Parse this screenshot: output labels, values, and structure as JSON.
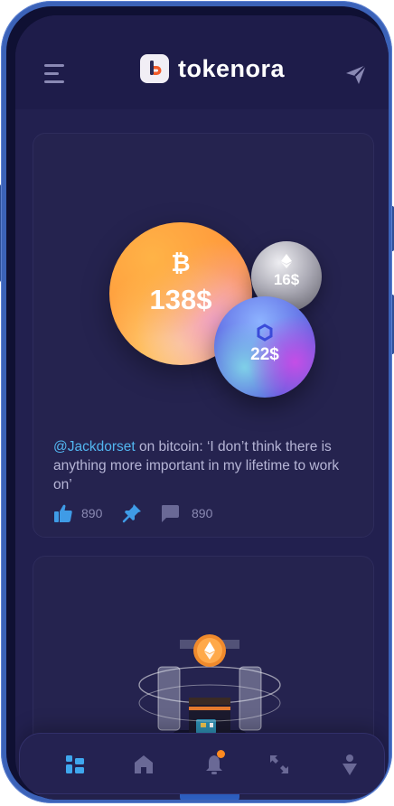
{
  "app": {
    "name": "tokenora"
  },
  "header": {
    "menu_icon": "hamburger-menu-icon",
    "send_icon": "paper-plane-icon"
  },
  "feed": {
    "post1": {
      "bubbles": [
        {
          "coin": "bitcoin",
          "icon": "bitcoin-icon",
          "value": "138$"
        },
        {
          "coin": "ethereum",
          "icon": "ethereum-icon",
          "value": "16$"
        },
        {
          "coin": "chainlink",
          "icon": "chainlink-icon",
          "value": "22$"
        }
      ],
      "handle": "@Jackdorset",
      "quote": " on bitcoin: ‘I don’t think there is anything more important in my lifetime to work on’",
      "likes": "890",
      "comments": "890"
    },
    "post2": {
      "image": "crypto-lock-illustration"
    }
  },
  "nav": {
    "items": [
      {
        "icon": "grid-icon",
        "active": true
      },
      {
        "icon": "home-icon",
        "active": false
      },
      {
        "icon": "bell-icon",
        "active": false,
        "badge": true
      },
      {
        "icon": "exchange-arrows-icon",
        "active": false
      },
      {
        "icon": "profile-icon",
        "active": false
      }
    ]
  },
  "colors": {
    "accent": "#52b6f0",
    "background": "#22204f",
    "notification": "#ff8a1f",
    "phone_frame": "#3b62b8"
  }
}
